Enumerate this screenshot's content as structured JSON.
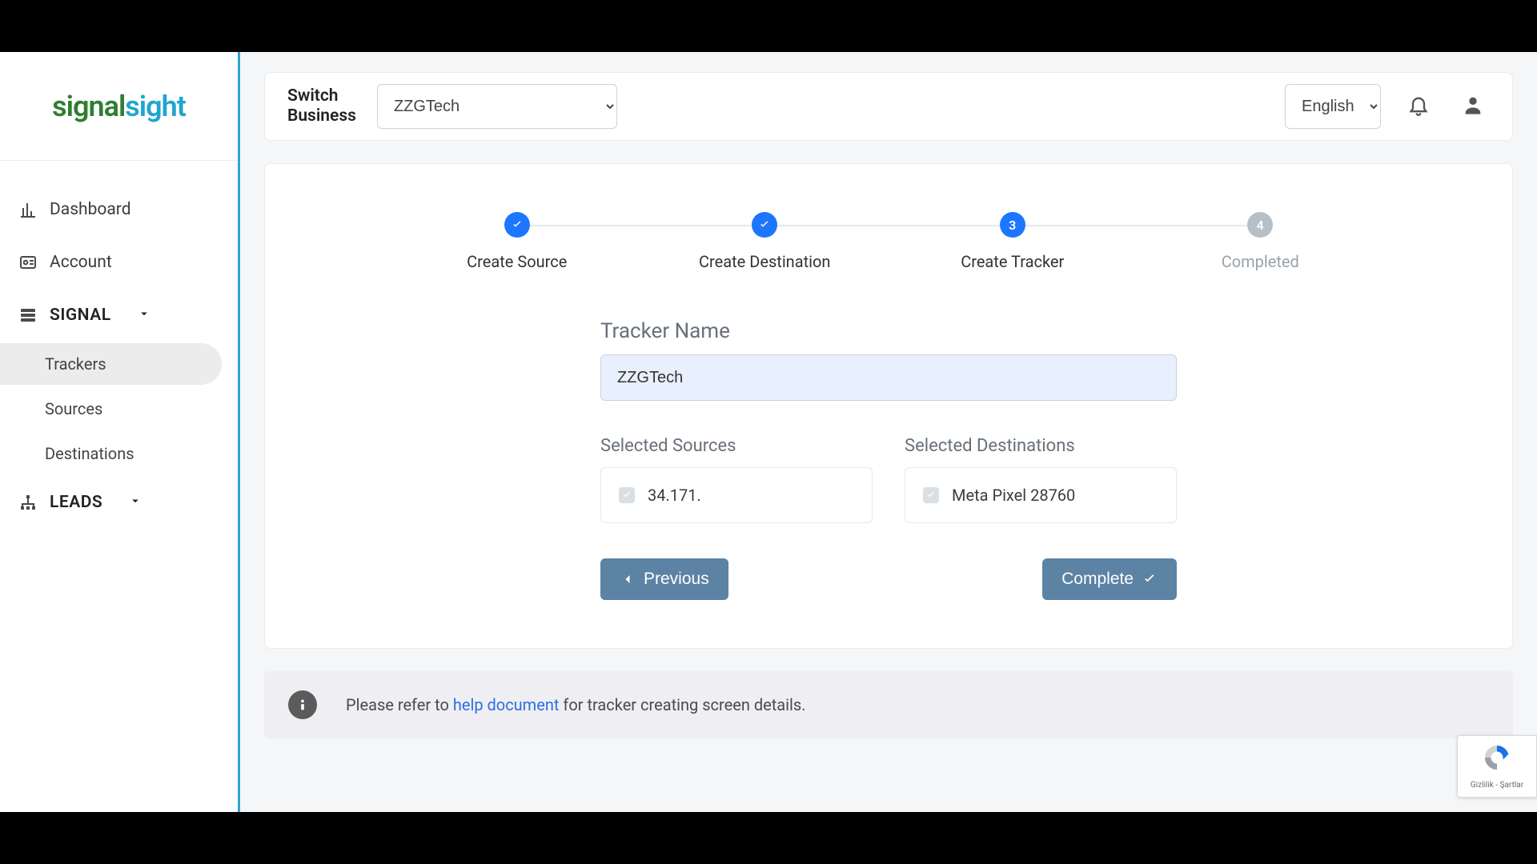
{
  "brand": {
    "part1": "signal",
    "part2": "sight"
  },
  "sidebar": {
    "dashboard": "Dashboard",
    "account": "Account",
    "signal_section": "SIGNAL",
    "signal_items": {
      "trackers": "Trackers",
      "sources": "Sources",
      "destinations": "Destinations"
    },
    "leads_section": "LEADS"
  },
  "header": {
    "switch_label_line1": "Switch",
    "switch_label_line2": "Business",
    "business_value": "ZZGTech",
    "lang_value": "English"
  },
  "stepper": {
    "step1": "Create Source",
    "step2": "Create Destination",
    "step3": "Create Tracker",
    "step3_num": "3",
    "step4": "Completed",
    "step4_num": "4"
  },
  "form": {
    "tracker_name_label": "Tracker Name",
    "tracker_name_value": "ZZGTech",
    "sources_label": "Selected Sources",
    "destinations_label": "Selected Destinations",
    "source_item": "34.171.",
    "destination_item": "Meta Pixel 28760",
    "previous_btn": "Previous",
    "complete_btn": "Complete"
  },
  "info": {
    "pre": "Please refer to ",
    "link": "help document",
    "post": " for tracker creating screen details."
  },
  "recaptcha": {
    "footer": "Gizlilik - Şartlar"
  }
}
